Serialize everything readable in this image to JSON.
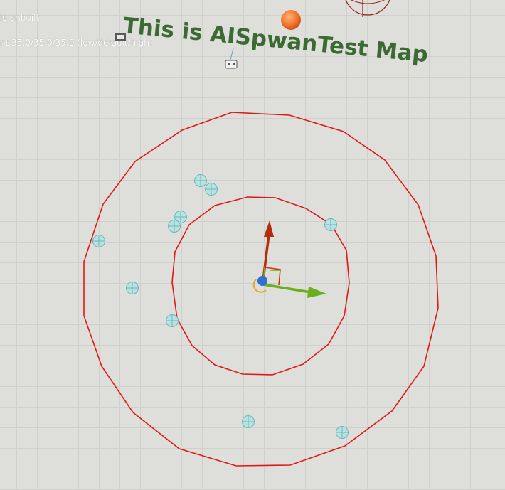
{
  "overlay": {
    "lighting_status": "is unbuilt",
    "lightmap_info": "nt 35.0/35.0/35.0 (low/default/high)"
  },
  "map_title": "This is AISpwanTest Map",
  "colors": {
    "radius_ring": "#e01818",
    "map_title": "#3c6a33",
    "gizmo_x": "#6ab01e",
    "gizmo_y": "#b22d0c",
    "gizmo_z": "#2f6fd6",
    "spawn_marker": "#a8dcdc",
    "orb": "#f07a2e"
  },
  "icons": [
    "camera-actor-icon",
    "player-start-icon",
    "light-orb-icon",
    "target-point-icon",
    "transform-gizmo-icon"
  ]
}
